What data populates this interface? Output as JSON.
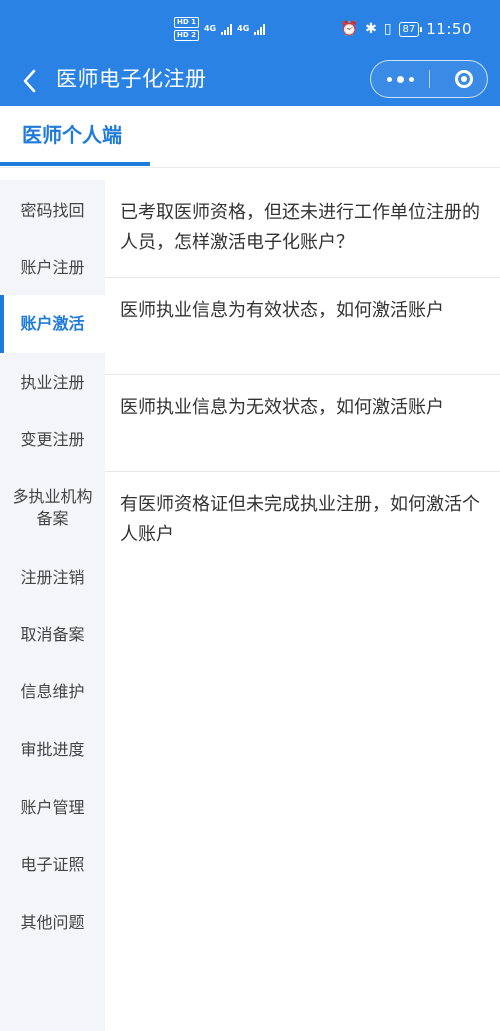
{
  "status_bar": {
    "hd1": "HD 1",
    "hd2": "HD 2",
    "net1": "4G",
    "net2": "4G",
    "battery": "87",
    "time": "11:50"
  },
  "nav": {
    "title": "医师电子化注册"
  },
  "tabs": [
    {
      "label": "医师个人端",
      "active": true
    }
  ],
  "sidebar": {
    "items": [
      {
        "label": "密码找回"
      },
      {
        "label": "账户注册"
      },
      {
        "label": "账户激活",
        "active": true
      },
      {
        "label": "执业注册"
      },
      {
        "label": "变更注册"
      },
      {
        "label": "多执业机构备案"
      },
      {
        "label": "注册注销"
      },
      {
        "label": "取消备案"
      },
      {
        "label": "信息维护"
      },
      {
        "label": "审批进度"
      },
      {
        "label": "账户管理"
      },
      {
        "label": "电子证照"
      },
      {
        "label": "其他问题"
      }
    ]
  },
  "questions": [
    {
      "text": "已考取医师资格，但还未进行工作单位注册的人员，怎样激活电子化账户？"
    },
    {
      "text": "医师执业信息为有效状态，如何激活账户"
    },
    {
      "text": "医师执业信息为无效状态，如何激活账户"
    },
    {
      "text": "有医师资格证但未完成执业注册，如何激活个人账户"
    }
  ],
  "colors": {
    "brand": "#2a82e4",
    "accent": "#1f7bd9",
    "sidebar_bg": "#f4f5f9"
  }
}
